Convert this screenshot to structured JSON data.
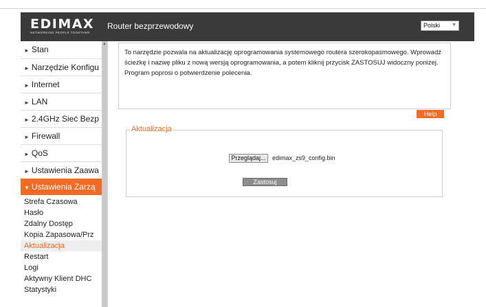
{
  "header": {
    "logo_text": "EDIMAX",
    "logo_tagline": "NETWORKING PEOPLE TOGETHER",
    "title": "Router bezprzewodowy",
    "language": "Polski"
  },
  "sidebar": {
    "items": [
      {
        "label": "Stan"
      },
      {
        "label": "Narzędzie Konfigu"
      },
      {
        "label": "Internet"
      },
      {
        "label": "LAN"
      },
      {
        "label": "2.4GHz Sieć Bezp"
      },
      {
        "label": "Firewall"
      },
      {
        "label": "QoS"
      },
      {
        "label": "Ustawienia Zaawa"
      },
      {
        "label": "Ustawienia Zarzą",
        "active": true
      }
    ],
    "subitems": [
      {
        "label": "Strefa Czasowa"
      },
      {
        "label": "Hasło"
      },
      {
        "label": "Zdalny Dostęp"
      },
      {
        "label": "Kopia Zapasowa/Prz"
      },
      {
        "label": "Aktualizacja",
        "active": true
      },
      {
        "label": "Restart"
      },
      {
        "label": "Logi"
      },
      {
        "label": "Aktywny Klient DHC"
      },
      {
        "label": "Statystyki"
      }
    ]
  },
  "main": {
    "description": "To narzędzie pozwala na aktualizację oprogramowania systemowego routera szerokopasmowego. Wprowadź ścieżkę i nazwę pliku z nową wersją oprogramowania, a potem kliknij przycisk ZASTOSUJ widoczny poniżej. Program poprosi o potwierdzenie polecenia.",
    "help_label": "Help",
    "section_title": "Aktualizacja",
    "browse_label": "Przeglądaj...",
    "file_name": "edimax_zs9_config.bin",
    "apply_label": "Zastosuj"
  },
  "colors": {
    "accent": "#f36a24",
    "header_bg": "#3a3a3a"
  }
}
